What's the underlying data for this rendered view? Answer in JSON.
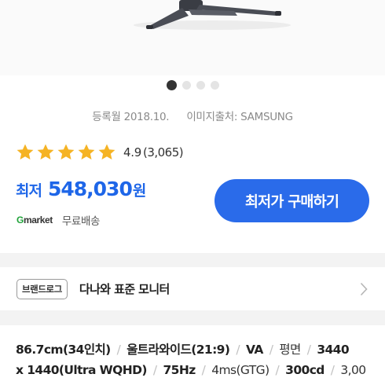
{
  "product_image": {
    "indicators": 4,
    "active_index": 0
  },
  "meta": {
    "registered": "등록월 2018.10.",
    "image_source": "이미지출처: SAMSUNG"
  },
  "rating": {
    "score": "4.9",
    "count": "(3,065)",
    "stars": 5
  },
  "price": {
    "label": "최저",
    "value": "548,030",
    "unit": "원"
  },
  "seller": {
    "logo_g": "G",
    "logo_rest": "market",
    "shipping": "무료배송"
  },
  "buy_button": {
    "label": "최저가 구매하기"
  },
  "brand": {
    "tag": "브랜드로그",
    "name": "다나와 표준 모니터"
  },
  "specs": {
    "line1": [
      "86.7cm(34인치)",
      "울트라와이드(21:9)",
      "VA",
      "평면",
      "3440"
    ],
    "line2": [
      "x 1440(Ultra WQHD)",
      "75Hz",
      "4ms(GTG)",
      "300cd",
      "3,00"
    ]
  },
  "colors": {
    "accent": "#2a6bea",
    "price": "#1e66e8",
    "star": "#f5b324",
    "gmarket_green": "#21a33a"
  }
}
